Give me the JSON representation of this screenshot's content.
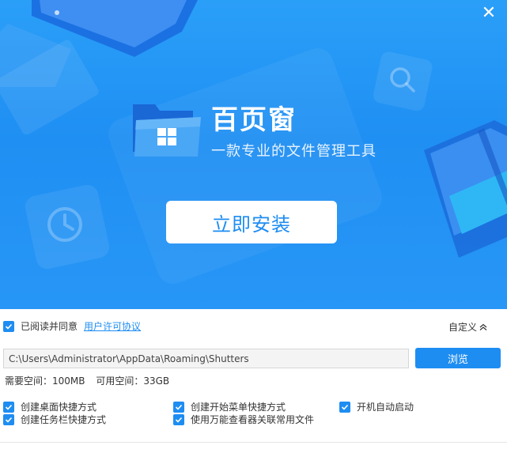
{
  "window": {
    "close_glyph": "✕"
  },
  "app": {
    "title": "百页窗",
    "subtitle": "一款专业的文件管理工具",
    "install_label": "立即安装"
  },
  "agreement": {
    "checked": true,
    "label": "已阅读并同意",
    "link": "用户许可协议"
  },
  "custom_label": "自定义",
  "install_path": {
    "value": "C:\\Users\\Administrator\\AppData\\Roaming\\Shutters",
    "browse_label": "浏览"
  },
  "disk": {
    "required": "需要空间：100MB",
    "available": "可用空间：33GB"
  },
  "options": [
    {
      "label": "创建桌面快捷方式",
      "checked": true
    },
    {
      "label": "创建开始菜单快捷方式",
      "checked": true
    },
    {
      "label": "开机自动启动",
      "checked": true
    },
    {
      "label": "创建任务栏快捷方式",
      "checked": true
    },
    {
      "label": "使用万能查看器关联常用文件",
      "checked": true
    }
  ],
  "colors": {
    "accent": "#1e8df2",
    "banner": "#2196f3",
    "background": "#ffffff"
  },
  "icons": [
    "close-icon",
    "folder-logo-icon",
    "windows-grid-icon",
    "checkbox-check-icon",
    "chevron-up-icon",
    "clock-icon",
    "search-icon",
    "notebook-icon",
    "tablet-icon"
  ]
}
